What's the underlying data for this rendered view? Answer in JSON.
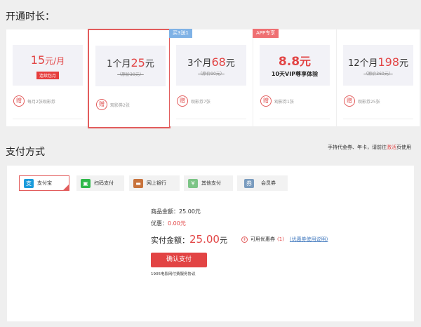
{
  "duration_section": {
    "title": "开通时长："
  },
  "plans": [
    {
      "tag": "",
      "price_num": "15",
      "price_unit": "元/月",
      "sub": "连续包月",
      "gift": "每月2张观影券"
    },
    {
      "tag": "",
      "prefix": "1个月",
      "price_num": "25",
      "price_unit": "元",
      "original": "（原价30元）",
      "gift": "观影券2张"
    },
    {
      "tag": "买3送1",
      "prefix": "3个月",
      "price_num": "68",
      "price_unit": "元",
      "original": "（原价90元）",
      "gift": "观影券7张"
    },
    {
      "tag": "APP专享",
      "price_num": "8.8",
      "price_unit": "元",
      "sub": "10天VIP尊享体验",
      "gift": "观影券1张"
    },
    {
      "tag": "",
      "prefix": "12个月",
      "price_num": "198",
      "price_unit": "元",
      "original": "（原价360元）",
      "gift": "观影券25张"
    }
  ],
  "payment_section": {
    "title": "支付方式",
    "note_pre": "手持代金券、年卡，请前往",
    "note_link": "激活",
    "note_post": "页使用"
  },
  "methods": [
    {
      "label": "支付宝",
      "icon": "alipay-icon",
      "color": "#1a9bdb",
      "glyph": "支"
    },
    {
      "label": "扫码支付",
      "icon": "qrcode-icon",
      "color": "#2fb84a",
      "glyph": "▣"
    },
    {
      "label": "网上银行",
      "icon": "bank-card-icon",
      "color": "#c8733c",
      "glyph": "▬"
    },
    {
      "label": "其他支付",
      "icon": "coin-icon",
      "color": "#7cc486",
      "glyph": "¥"
    },
    {
      "label": "会员券",
      "icon": "ticket-icon",
      "color": "#7a9cbf",
      "glyph": "券"
    }
  ],
  "order": {
    "goods_label": "商品金额：",
    "goods_amount": "25.00元",
    "discount_label": "优惠：",
    "discount_amount": "0.00元",
    "actual_label": "实付金额：",
    "actual_num": "25.00",
    "actual_unit": "元",
    "coupon_label": "可用优惠券",
    "coupon_count": "(1)",
    "coupon_link": "(优惠券使用说明)",
    "confirm": "确认支付",
    "agreement": "1905电影网付费服务协议"
  }
}
